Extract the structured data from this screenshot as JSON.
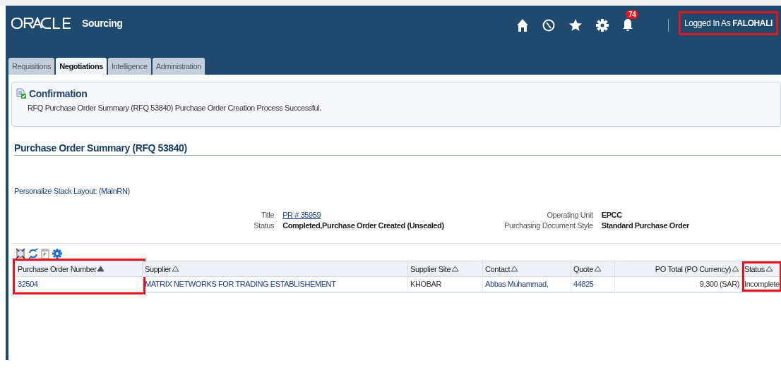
{
  "header": {
    "product": "Sourcing",
    "notification_count": "74",
    "user_label": "Logged In As",
    "user_name": "FALOHALI",
    "user_highlighted": true
  },
  "tabs": [
    {
      "label": "Requisitions",
      "selected": false
    },
    {
      "label": "Negotiations",
      "selected": true
    },
    {
      "label": "Intelligence",
      "selected": false
    },
    {
      "label": "Administration",
      "selected": false
    }
  ],
  "confirmation": {
    "title": "Confirmation",
    "message": "RFQ Purchase Order Summary (RFQ 53840) Purchase Order Creation Process Successful."
  },
  "section_title": "Purchase Order Summary (RFQ 53840)",
  "personalize_link": "Personalize Stack Layout: (MainRN)",
  "details_left": [
    {
      "label": "Title",
      "value": "PR # 35959",
      "kind": "link"
    },
    {
      "label": "Status",
      "value": "Completed,Purchase Order Created (Unsealed)",
      "kind": "bold"
    }
  ],
  "details_right": [
    {
      "label": "Operating Unit",
      "value": "EPCC"
    },
    {
      "label": "Purchasing Document Style",
      "value": "Standard Purchase Order"
    }
  ],
  "table": {
    "columns": [
      {
        "label": "Purchase Order Number",
        "sorted": true,
        "highlighted": true
      },
      {
        "label": "Supplier",
        "sorted": false,
        "highlighted": false
      },
      {
        "label": "Supplier Site",
        "sorted": false,
        "highlighted": false
      },
      {
        "label": "Contact",
        "sorted": false,
        "highlighted": false
      },
      {
        "label": "Quote",
        "sorted": false,
        "highlighted": false
      },
      {
        "label": "PO Total (PO Currency)",
        "sorted": false,
        "highlighted": false
      },
      {
        "label": "Status",
        "sorted": false,
        "highlighted": true
      }
    ],
    "rows": [
      {
        "cells": [
          {
            "text": "32504",
            "kind": "link"
          },
          {
            "text": "MATRIX NETWORKS FOR TRADING ESTABLISHEMENT",
            "kind": "link"
          },
          {
            "text": "KHOBAR",
            "kind": "text"
          },
          {
            "text": "Abbas Muhammad,",
            "kind": "link"
          },
          {
            "text": "44825",
            "kind": "link"
          },
          {
            "text": "9,300 (SAR)",
            "kind": "text"
          },
          {
            "text": "Incomplete",
            "kind": "text"
          }
        ]
      }
    ]
  }
}
